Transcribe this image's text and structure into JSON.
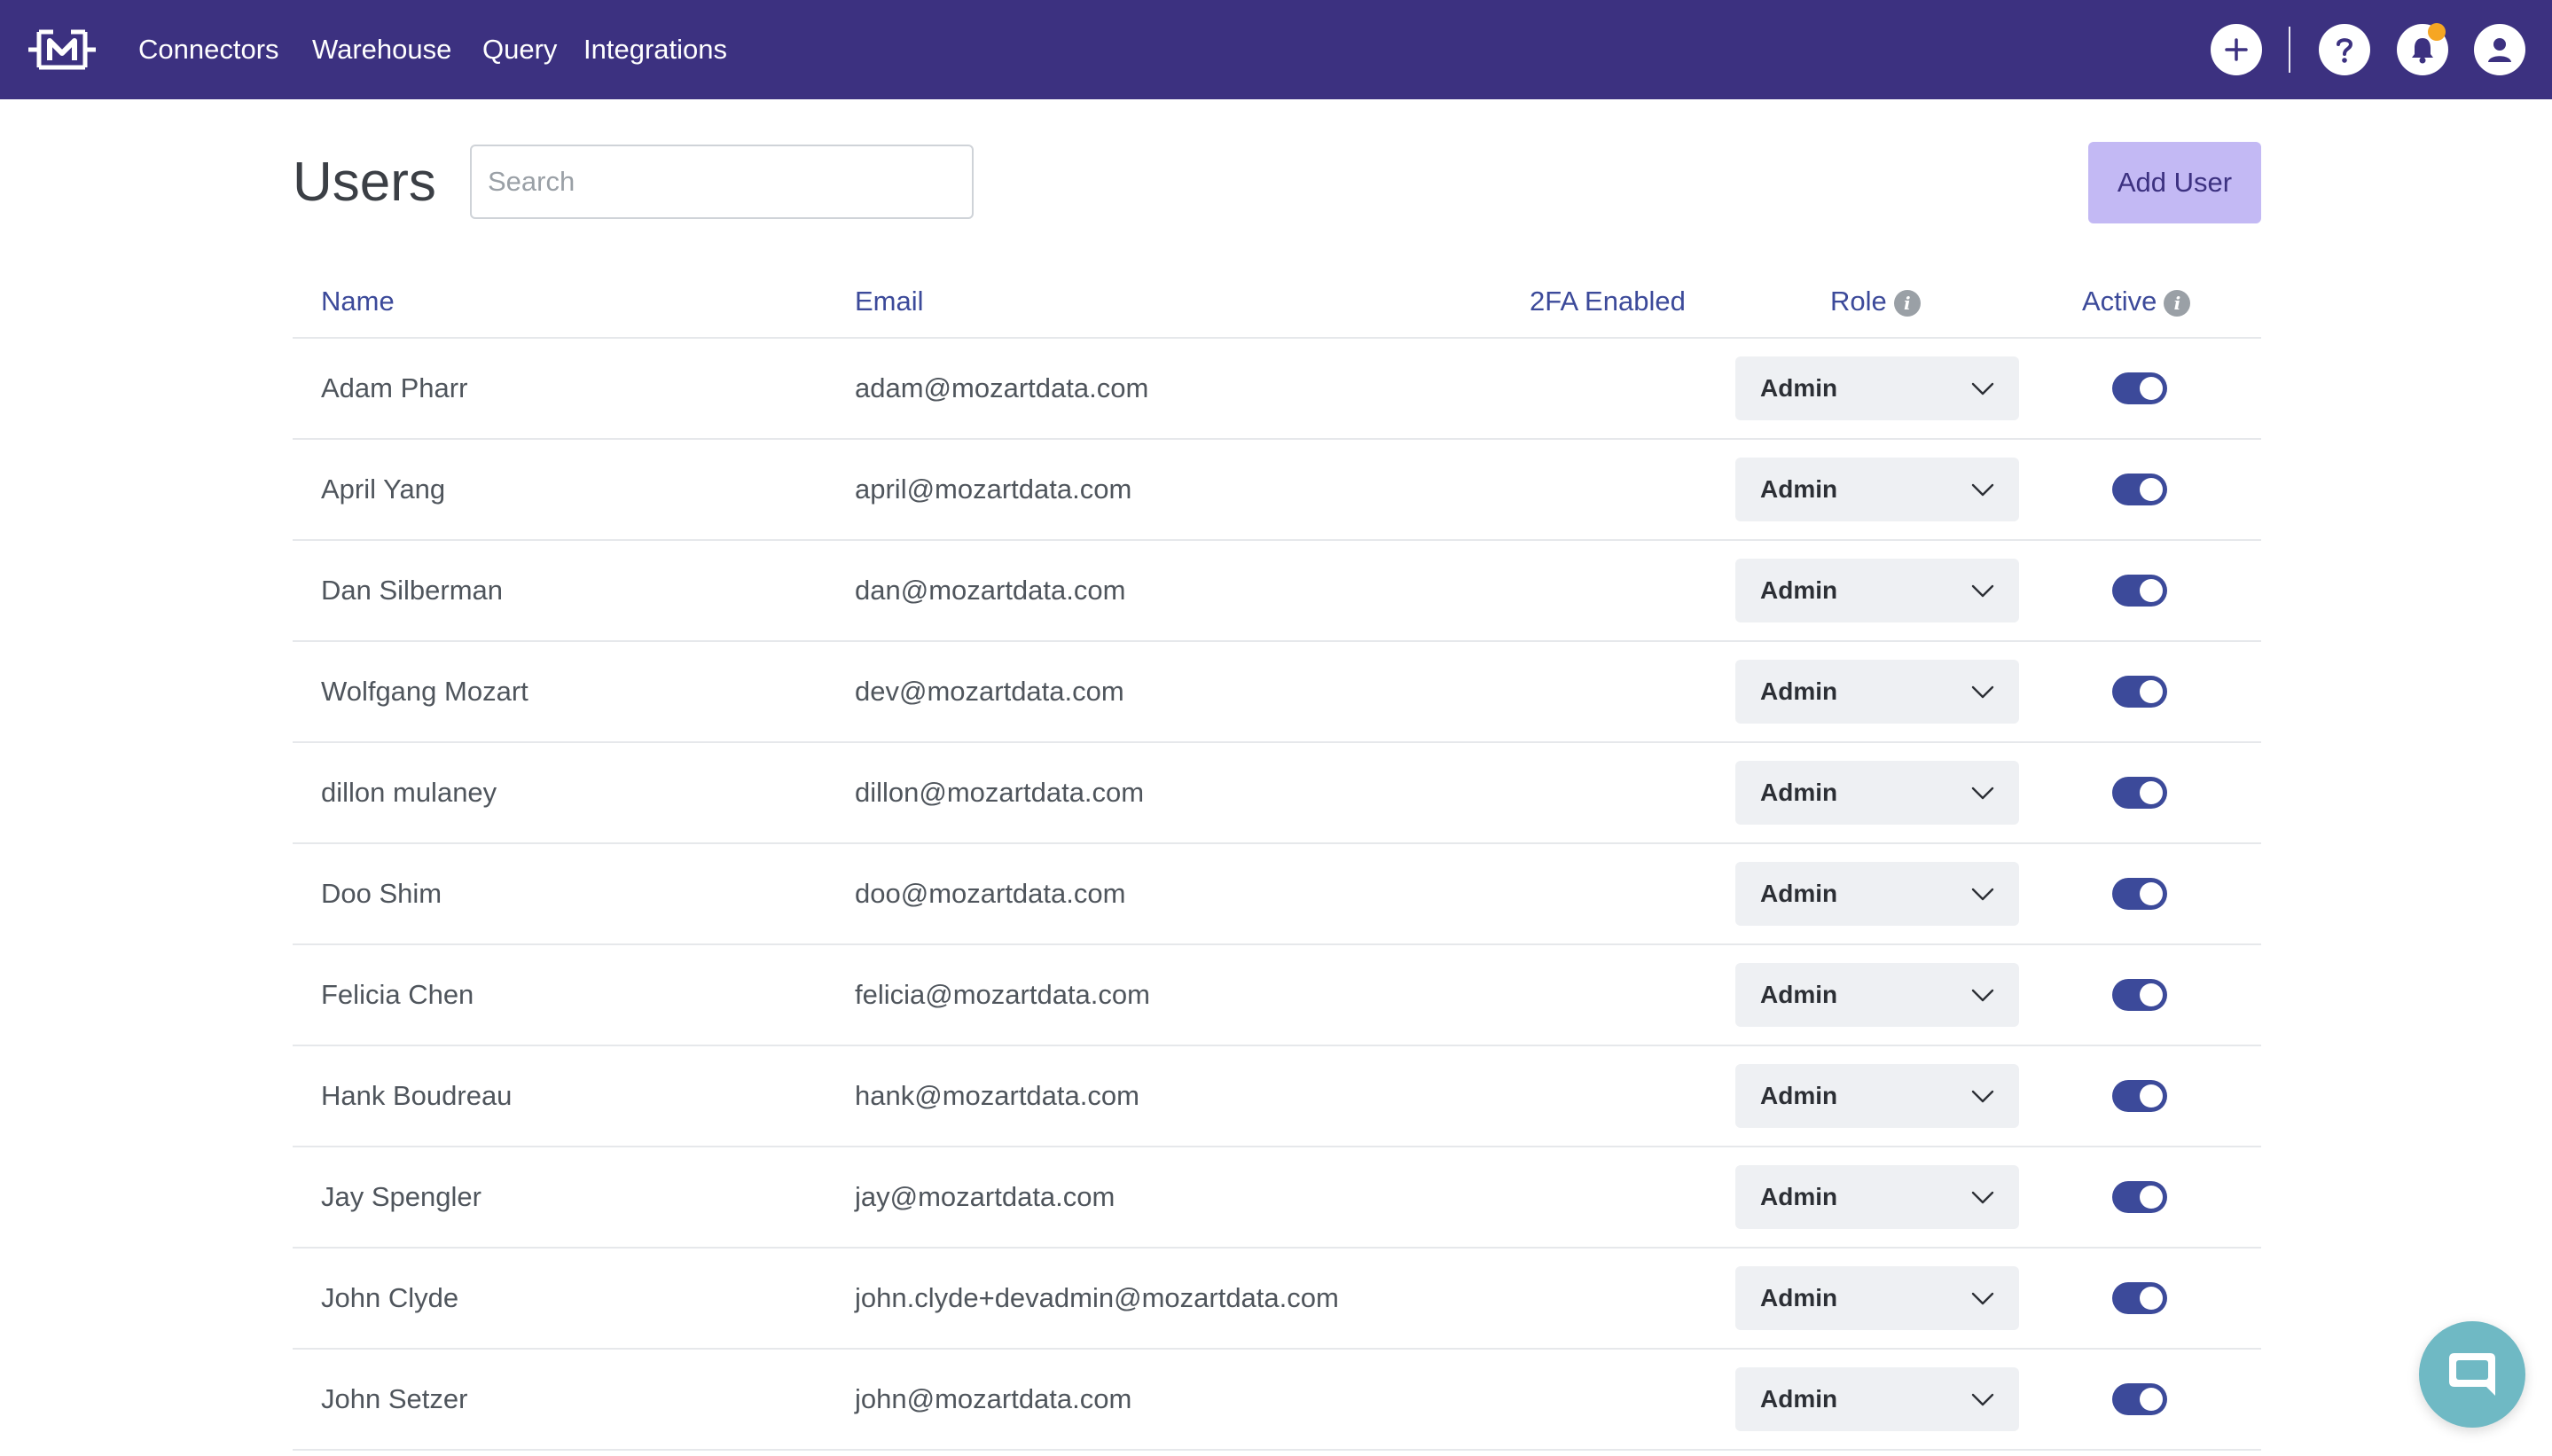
{
  "nav": {
    "links": [
      "Connectors",
      "Warehouse",
      "Query",
      "Integrations"
    ],
    "icons": [
      "plus-icon",
      "help-icon",
      "bell-icon",
      "user-icon"
    ],
    "notification_dot_color": "#f6a623",
    "bar_color": "#3c3180"
  },
  "page": {
    "title": "Users",
    "search_placeholder": "Search",
    "search_value": "",
    "add_user_label": "Add User"
  },
  "table": {
    "headers": {
      "name": "Name",
      "email": "Email",
      "two_fa": "2FA Enabled",
      "role": "Role",
      "active": "Active"
    },
    "rows": [
      {
        "name": "Adam Pharr",
        "email": "adam@mozartdata.com",
        "role": "Admin",
        "active": true
      },
      {
        "name": "April Yang",
        "email": "april@mozartdata.com",
        "role": "Admin",
        "active": true
      },
      {
        "name": "Dan Silberman",
        "email": "dan@mozartdata.com",
        "role": "Admin",
        "active": true
      },
      {
        "name": "Wolfgang Mozart",
        "email": "dev@mozartdata.com",
        "role": "Admin",
        "active": true
      },
      {
        "name": "dillon mulaney",
        "email": "dillon@mozartdata.com",
        "role": "Admin",
        "active": true
      },
      {
        "name": "Doo Shim",
        "email": "doo@mozartdata.com",
        "role": "Admin",
        "active": true
      },
      {
        "name": "Felicia Chen",
        "email": "felicia@mozartdata.com",
        "role": "Admin",
        "active": true
      },
      {
        "name": "Hank Boudreau",
        "email": "hank@mozartdata.com",
        "role": "Admin",
        "active": true
      },
      {
        "name": "Jay Spengler",
        "email": "jay@mozartdata.com",
        "role": "Admin",
        "active": true
      },
      {
        "name": "John Clyde",
        "email": "john.clyde+devadmin@mozartdata.com",
        "role": "Admin",
        "active": true
      },
      {
        "name": "John Setzer",
        "email": "john@mozartdata.com",
        "role": "Admin",
        "active": true
      }
    ]
  },
  "chat": {
    "icon": "chat-icon",
    "color": "#6fb9c4"
  }
}
